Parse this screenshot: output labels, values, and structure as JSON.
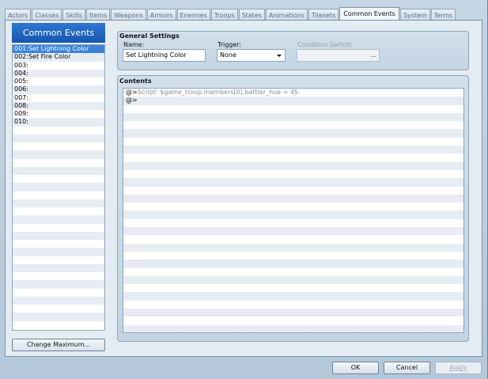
{
  "tabs": [
    "Actors",
    "Classes",
    "Skills",
    "Items",
    "Weapons",
    "Armors",
    "Enemies",
    "Troops",
    "States",
    "Animations",
    "Tilesets",
    "Common Events",
    "System",
    "Terms"
  ],
  "active_tab": "Common Events",
  "list": {
    "header": "Common Events",
    "items": [
      "001:Set Lightning Color",
      "002:Set Fire Color",
      "003:",
      "004:",
      "005:",
      "006:",
      "007:",
      "008:",
      "009:",
      "010:"
    ],
    "selected_index": 0,
    "change_max_label": "Change Maximum..."
  },
  "general": {
    "title": "General Settings",
    "name_label": "Name:",
    "name_value": "Set Lightning Color",
    "trigger_label": "Trigger:",
    "trigger_value": "None",
    "switch_label": "Condition Switch:",
    "switch_button": "..."
  },
  "contents": {
    "title": "Contents",
    "lines": [
      {
        "prefix": "@>",
        "text": "Script: $game_troop.members[0].battler_hue = 45"
      },
      {
        "prefix": "@>",
        "text": ""
      }
    ]
  },
  "footer": {
    "ok": "OK",
    "cancel": "Cancel",
    "apply": "Apply"
  },
  "colors": {
    "selection": "#3b82d8",
    "header": "#1f66c2",
    "background": "#b7cbdb"
  }
}
